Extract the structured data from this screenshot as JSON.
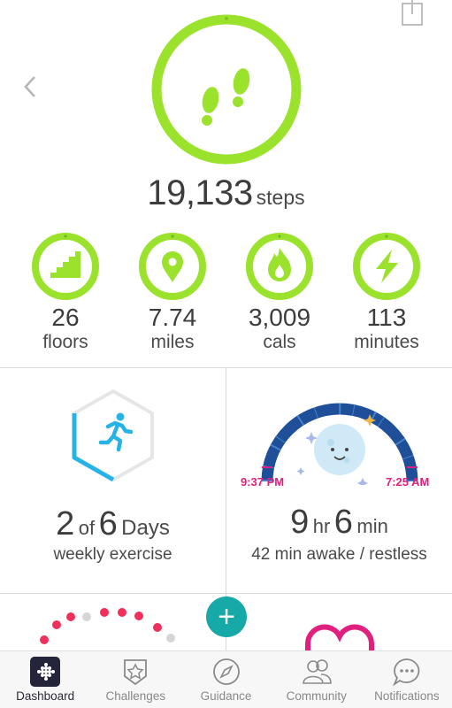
{
  "header": {
    "back_icon": "chevron-left-icon",
    "share_icon": "share-icon"
  },
  "steps": {
    "value": "19,133",
    "unit": "steps",
    "icon": "footprints-icon",
    "goal_progress": 1.0,
    "ring_color": "#9be22d"
  },
  "stats": [
    {
      "value": "26",
      "unit": "floors",
      "icon": "stairs-icon"
    },
    {
      "value": "7.74",
      "unit": "miles",
      "icon": "location-pin-icon"
    },
    {
      "value": "3,009",
      "unit": "cals",
      "icon": "flame-icon"
    },
    {
      "value": "113",
      "unit": "minutes",
      "icon": "lightning-icon"
    }
  ],
  "exercise": {
    "count": "2",
    "of": "of",
    "goal": "6",
    "days": "Days",
    "caption": "weekly exercise",
    "progress_fraction": 0.333,
    "accent": "#27b3e6"
  },
  "sleep": {
    "start": "9:37 PM",
    "end": "7:25 AM",
    "hours": "9",
    "hr": "hr",
    "minutes": "6",
    "min": "min",
    "caption": "42 min awake / restless",
    "accent": "#e0207f",
    "arc_color": "#1f4f99"
  },
  "fab": {
    "label": "+"
  },
  "tabs": [
    {
      "label": "Dashboard",
      "icon": "dashboard-grid-icon",
      "active": true
    },
    {
      "label": "Challenges",
      "icon": "star-badge-icon",
      "active": false
    },
    {
      "label": "Guidance",
      "icon": "compass-icon",
      "active": false
    },
    {
      "label": "Community",
      "icon": "people-icon",
      "active": false
    },
    {
      "label": "Notifications",
      "icon": "chat-bubble-icon",
      "active": false
    }
  ]
}
